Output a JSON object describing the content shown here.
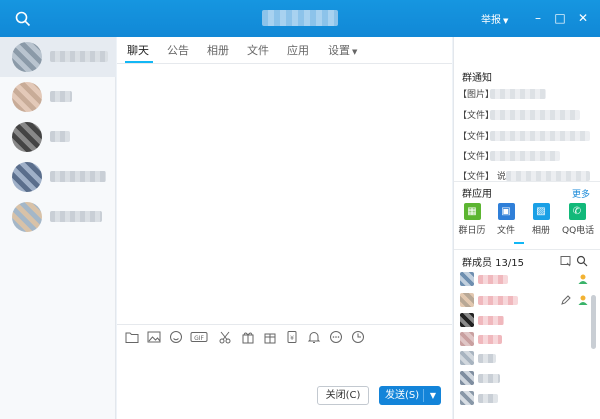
{
  "titlebar": {
    "report_label": "举报",
    "minimize": "–",
    "maximize": "□",
    "close": "✕"
  },
  "tabs": [
    {
      "label": "聊天"
    },
    {
      "label": "公告"
    },
    {
      "label": "相册"
    },
    {
      "label": "文件"
    },
    {
      "label": "应用"
    },
    {
      "label": "设置"
    }
  ],
  "toolbar": {
    "icons": [
      "folder-icon",
      "image-icon",
      "emoji-icon",
      "gif-icon",
      "scissors-icon",
      "gift-icon",
      "gift-box-icon",
      "red-packet-icon",
      "bell-icon",
      "more-icon",
      "clock-icon"
    ]
  },
  "buttons": {
    "close_label": "关闭(C)",
    "send_label": "发送(S)",
    "send_arrow": "▼"
  },
  "notice": {
    "title": "群通知",
    "items": [
      "【图片】",
      "【文件】",
      "【文件】",
      "【文件】",
      "【文件】 说"
    ]
  },
  "apps": {
    "title": "群应用",
    "more_label": "更多",
    "items": [
      {
        "label": "群日历",
        "color": "#5cb531",
        "glyph": "▦"
      },
      {
        "label": "文件",
        "color": "#2f7fd8",
        "glyph": "▣"
      },
      {
        "label": "相册",
        "color": "#1aa0e6",
        "glyph": "▨"
      },
      {
        "label": "QQ电话",
        "color": "#12b97a",
        "glyph": "✆"
      }
    ]
  },
  "members": {
    "title": "群成员 13/15"
  },
  "colors": {
    "titlebar": "#1188d6",
    "accent": "#12b7f5",
    "send_button": "#1384d9"
  }
}
